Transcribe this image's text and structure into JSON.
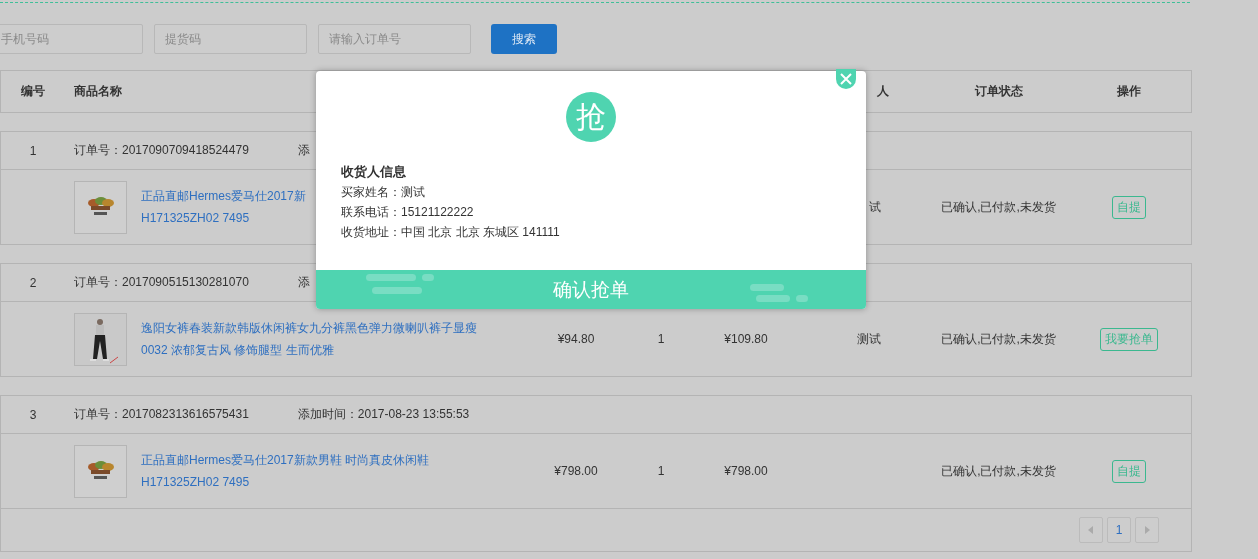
{
  "search": {
    "fields": [
      {
        "placeholder": "手机号码"
      },
      {
        "placeholder": "提货码"
      },
      {
        "placeholder": "请输入订单号"
      }
    ],
    "button": "搜索"
  },
  "table": {
    "header": {
      "number": "编号",
      "name": "商品名称",
      "column_6": "人",
      "status": "订单状态",
      "action": "操作"
    },
    "orders": [
      {
        "index": "1",
        "order_no": "订单号：2017090709418524479",
        "added": "添",
        "title_lines": [
          "正品直邮Hermes爱马仕2017新",
          "H171325ZH02 7495"
        ],
        "column_6": "试",
        "status": "已确认,已付款,未发货",
        "action": "自提"
      },
      {
        "index": "2",
        "order_no": "订单号：2017090515130281070",
        "added": "添",
        "title_lines": [
          "逸阳女裤春装新款韩版休闲裤女九分裤黑色弹力微喇叭裤子显瘦",
          "0032 浓郁复古风 修饰腿型 生而优雅"
        ],
        "price": "¥94.80",
        "qty": "1",
        "total": "¥109.80",
        "column_6": "测试",
        "status": "已确认,已付款,未发货",
        "action": "我要抢单"
      },
      {
        "index": "3",
        "order_no": "订单号：2017082313616575431",
        "added": "添加时间：2017-08-23 13:55:53",
        "title_lines": [
          "正品直邮Hermes爱马仕2017新款男鞋 时尚真皮休闲鞋",
          "H171325ZH02 7495"
        ],
        "price": "¥798.00",
        "qty": "1",
        "total": "¥798.00",
        "status": "已确认,已付款,未发货",
        "action": "自提"
      }
    ]
  },
  "pagination": {
    "pages": [
      {
        "label": "1",
        "selected": true
      }
    ]
  },
  "modal": {
    "badge": "抢",
    "section_title": "收货人信息",
    "lines": [
      "买家姓名：测试",
      "联系电话：15121122222",
      "收货地址：中国 北京 北京 东城区 141111"
    ],
    "confirm": "确认抢单"
  }
}
